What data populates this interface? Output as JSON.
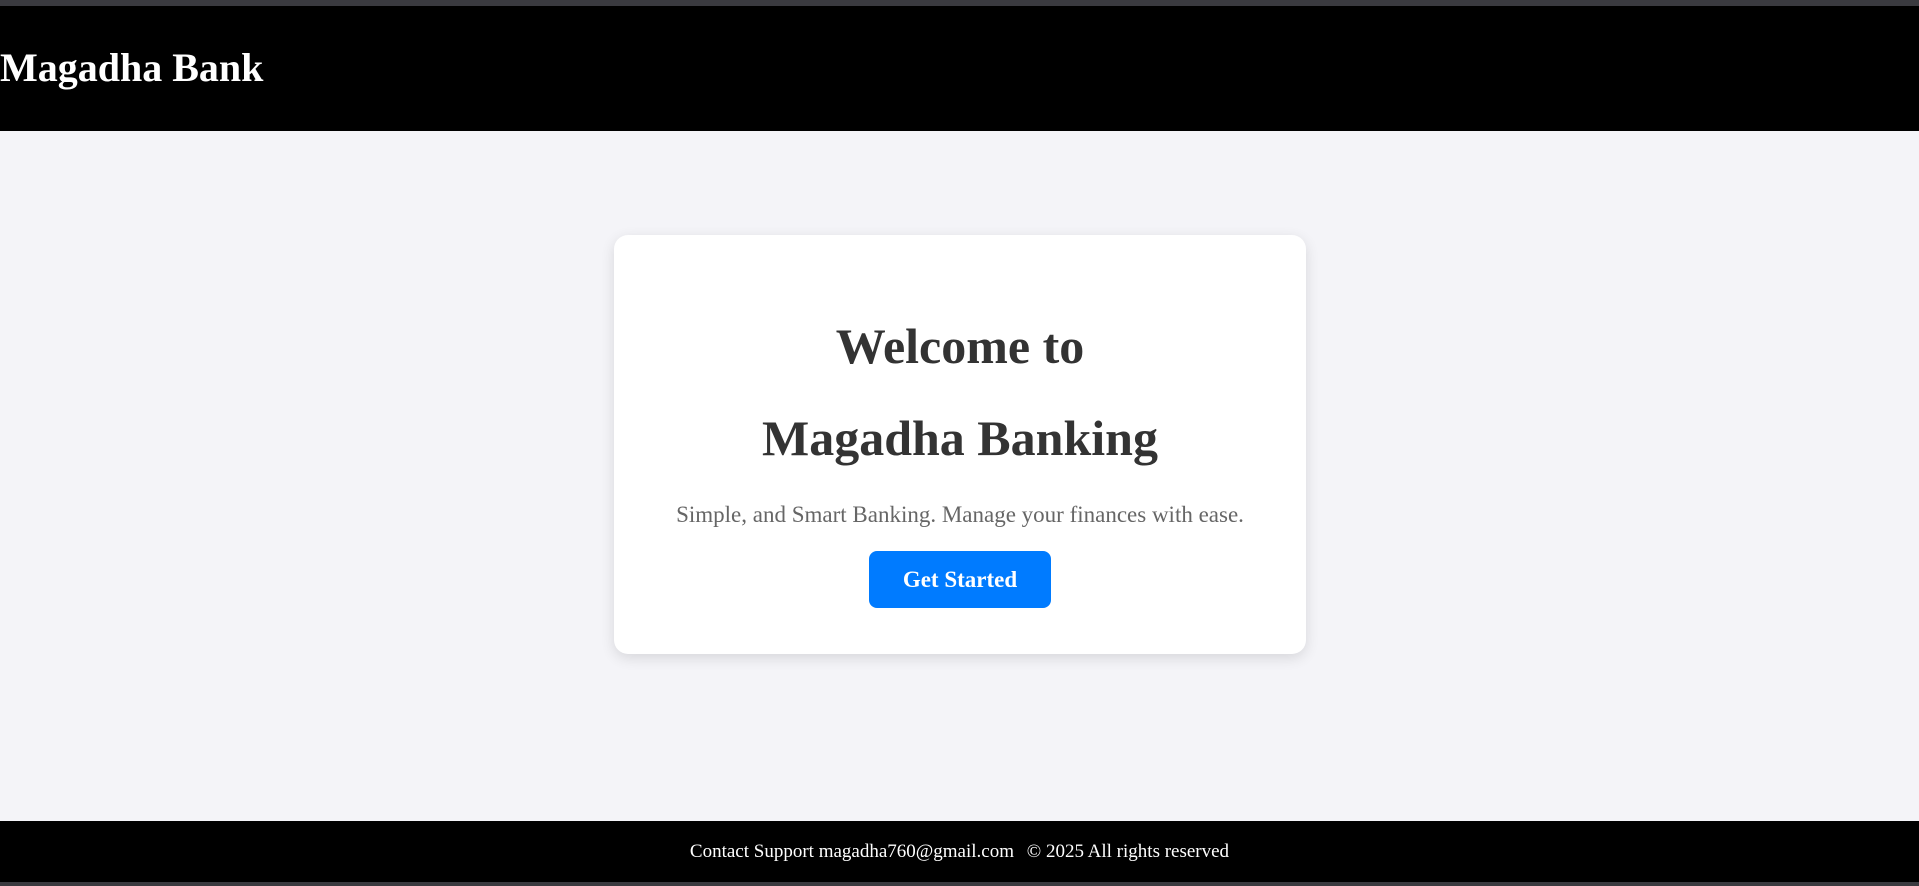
{
  "header": {
    "brand": "Magadha Bank"
  },
  "hero": {
    "title_line_1": "Welcome to",
    "title_line_2": "Magadha Banking",
    "tagline": "Simple, and Smart Banking. Manage your finances with ease.",
    "cta_label": "Get Started"
  },
  "footer": {
    "contact_label": "Contact Support",
    "email": "magadha760@gmail.com",
    "copyright": "© 2025 All rights reserved"
  },
  "colors": {
    "header_bg": "#000000",
    "page_bg": "#f4f4f8",
    "card_bg": "#ffffff",
    "cta_bg": "#007bff",
    "heading_text": "#333333",
    "tagline_text": "#666666"
  }
}
